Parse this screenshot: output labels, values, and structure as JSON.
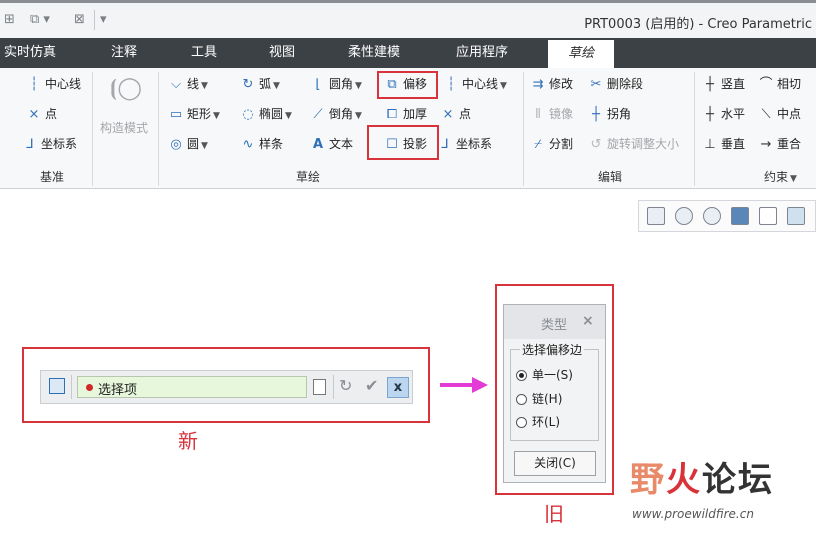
{
  "window": {
    "title": "PRT0003 (启用的) - Creo Parametric",
    "quick_access_icons": [
      "regenerate-icon",
      "windows-icon",
      "close-window-icon",
      "customize-dropdown-icon"
    ]
  },
  "tabs": [
    {
      "label": "实时仿真",
      "active": false
    },
    {
      "label": "注释",
      "active": false
    },
    {
      "label": "工具",
      "active": false
    },
    {
      "label": "视图",
      "active": false
    },
    {
      "label": "柔性建模",
      "active": false
    },
    {
      "label": "应用程序",
      "active": false
    },
    {
      "label": "草绘",
      "active": true
    }
  ],
  "ribbon": {
    "datum": {
      "items": [
        "中心线",
        "点",
        "坐标系"
      ],
      "group_label": "基准"
    },
    "construction": {
      "label": "构造模式"
    },
    "sketch": {
      "col1": [
        "线",
        "矩形",
        "圆"
      ],
      "col2": [
        "弧",
        "椭圆",
        "样条"
      ],
      "col3": [
        "圆角",
        "倒角",
        "文本"
      ],
      "col4": [
        "偏移",
        "加厚",
        "投影"
      ],
      "col5": [
        "中心线",
        "点",
        "坐标系"
      ],
      "group_label": "草绘"
    },
    "edit": {
      "col1": [
        "修改",
        "镜像",
        "分割"
      ],
      "col2": [
        "删除段",
        "拐角",
        "旋转调整大小"
      ],
      "group_label": "编辑"
    },
    "constrain": {
      "col1": [
        "竖直",
        "水平",
        "垂直"
      ],
      "col2": [
        "相切",
        "中点",
        "重合"
      ],
      "group_label": "约束"
    }
  },
  "view_toolbar": {
    "icons": [
      "zoom-fit-icon",
      "zoom-in-icon",
      "zoom-out-icon",
      "repaint-icon",
      "orient-icon",
      "saved-views-icon"
    ]
  },
  "new_dashboard": {
    "field_text": "选择项",
    "caption": "新",
    "close_symbol": "x"
  },
  "old_dialog": {
    "title": "类型",
    "close_symbol": "×",
    "group_label": "选择偏移边",
    "options": [
      {
        "label": "单一(S)",
        "selected": true
      },
      {
        "label": "链(H)",
        "selected": false
      },
      {
        "label": "环(L)",
        "selected": false
      }
    ],
    "close_button": "关闭(C)",
    "caption": "旧"
  },
  "watermark": {
    "text_part1": "野",
    "text_part2": "火",
    "text_part3": "论坛",
    "url": "www.proewildfire.cn"
  },
  "colors": {
    "highlight_red": "#d8323a",
    "arrow_magenta": "#e43ad6",
    "tab_bar": "#3c4146",
    "field_green": "#e6f7dc"
  }
}
